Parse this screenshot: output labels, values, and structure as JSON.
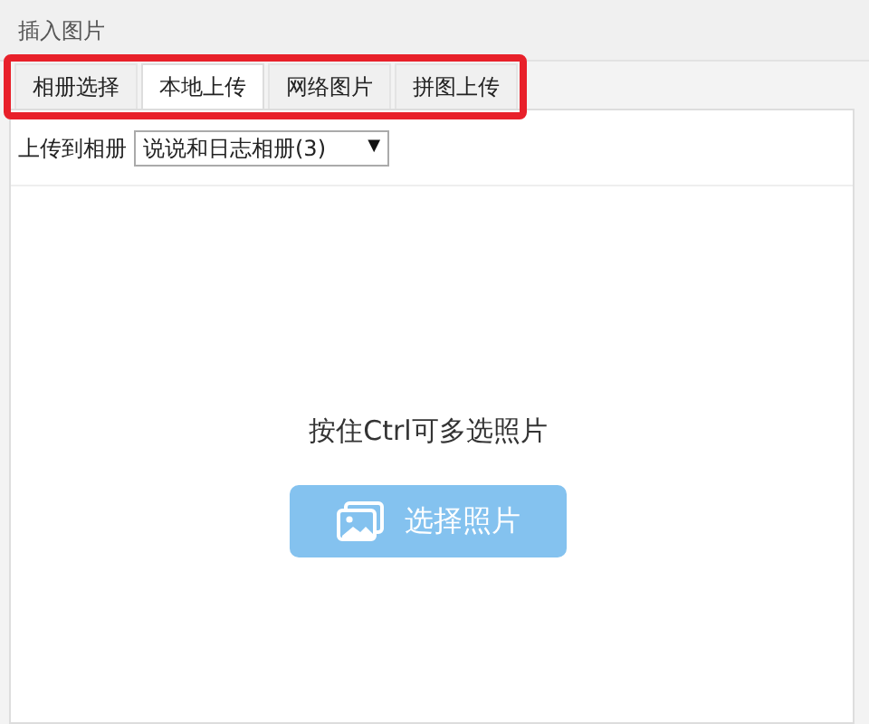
{
  "window": {
    "title": "插入图片"
  },
  "tabs": {
    "highlighted": true,
    "items": [
      {
        "label": "相册选择",
        "selected": false
      },
      {
        "label": "本地上传",
        "selected": true
      },
      {
        "label": "网络图片",
        "selected": false
      },
      {
        "label": "拼图上传",
        "selected": false
      }
    ]
  },
  "album": {
    "label": "上传到相册",
    "value": "说说和日志相册(3)",
    "arrow": "▼"
  },
  "hint": "按住Ctrl可多选照片",
  "upload_button": {
    "label": "选择照片"
  }
}
